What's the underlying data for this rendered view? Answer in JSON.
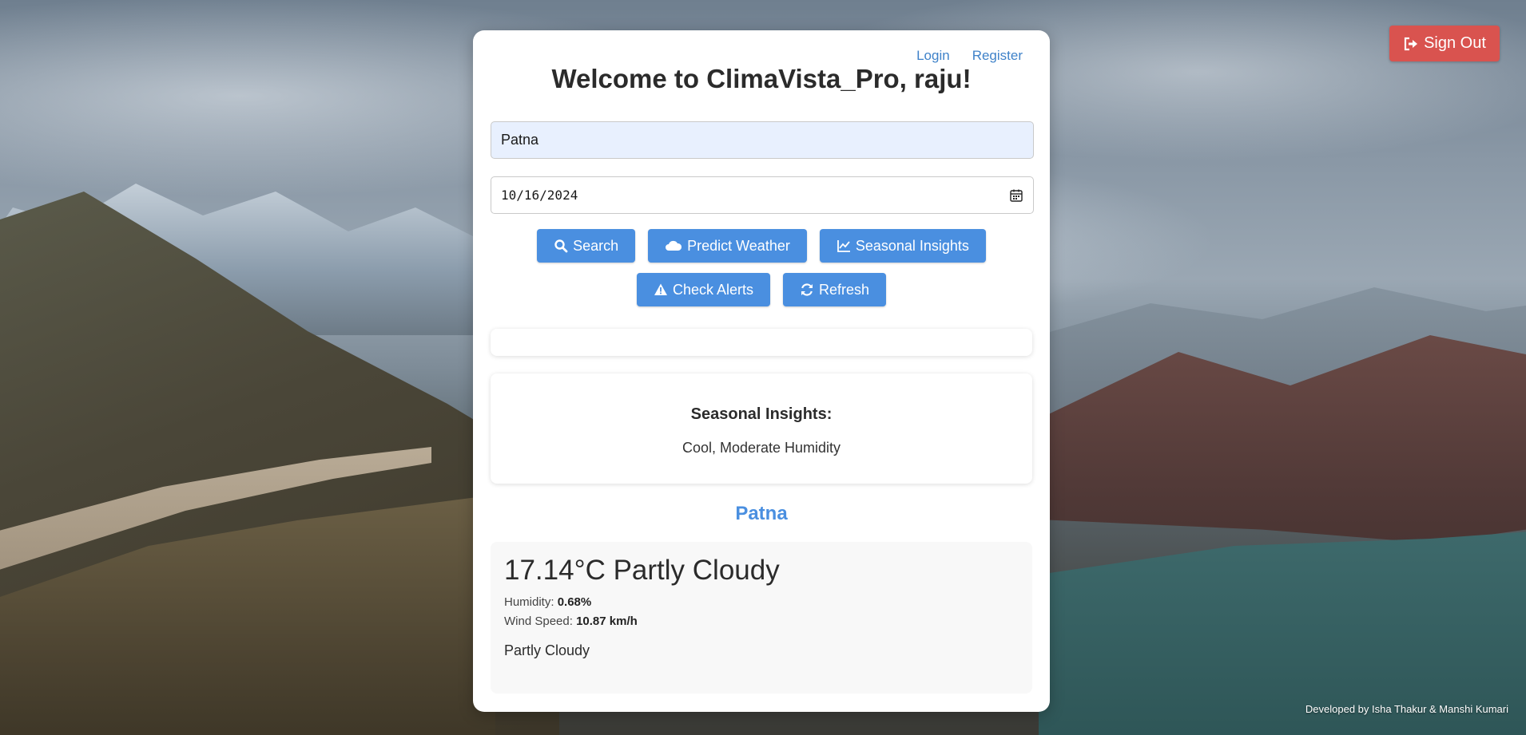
{
  "header": {
    "sign_out_label": "Sign Out",
    "login_label": "Login",
    "register_label": "Register",
    "welcome_text": "Welcome to ClimaVista_Pro, raju!"
  },
  "form": {
    "city_value": "Patna",
    "date_value": "10/16/2024"
  },
  "buttons": {
    "search": "Search",
    "predict": "Predict Weather",
    "seasonal": "Seasonal Insights",
    "alerts": "Check Alerts",
    "refresh": "Refresh"
  },
  "insights": {
    "title": "Seasonal Insights:",
    "text": "Cool, Moderate Humidity"
  },
  "weather": {
    "city": "Patna",
    "headline": "17.14°C Partly Cloudy",
    "humidity_label": "Humidity:",
    "humidity_value": "0.68%",
    "wind_label": "Wind Speed:",
    "wind_value": "10.87 km/h",
    "description": "Partly Cloudy"
  },
  "footer": {
    "credit": "Developed by Isha Thakur & Manshi Kumari"
  },
  "colors": {
    "primary": "#4a8fe0",
    "danger": "#d9534f",
    "link": "#3f82c9"
  }
}
